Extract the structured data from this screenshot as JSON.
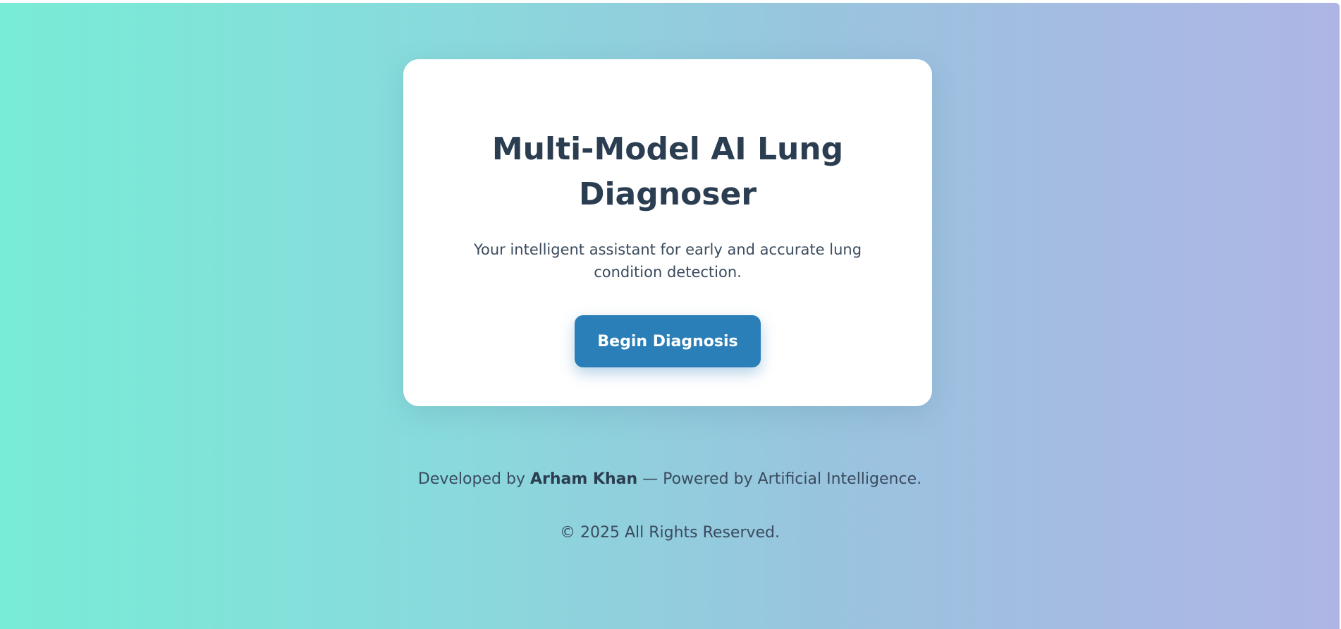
{
  "theme": {
    "gradient_start": "#78ecd6",
    "gradient_end": "#aeb5e5",
    "card_background": "#ffffff",
    "title_color": "#2b3d50",
    "button_color": "#2b7fb8",
    "button_text_color": "#ffffff"
  },
  "hero": {
    "title": "Multi-Model AI Lung Diagnoser",
    "subtitle": "Your intelligent assistant for early and accurate lung condition detection.",
    "button_label": "Begin Diagnosis"
  },
  "footer": {
    "credit_prefix": "Developed by ",
    "credit_author": "Arham Khan",
    "credit_suffix": " — Powered by Artificial Intelligence.",
    "copyright": "© 2025 All Rights Reserved."
  }
}
